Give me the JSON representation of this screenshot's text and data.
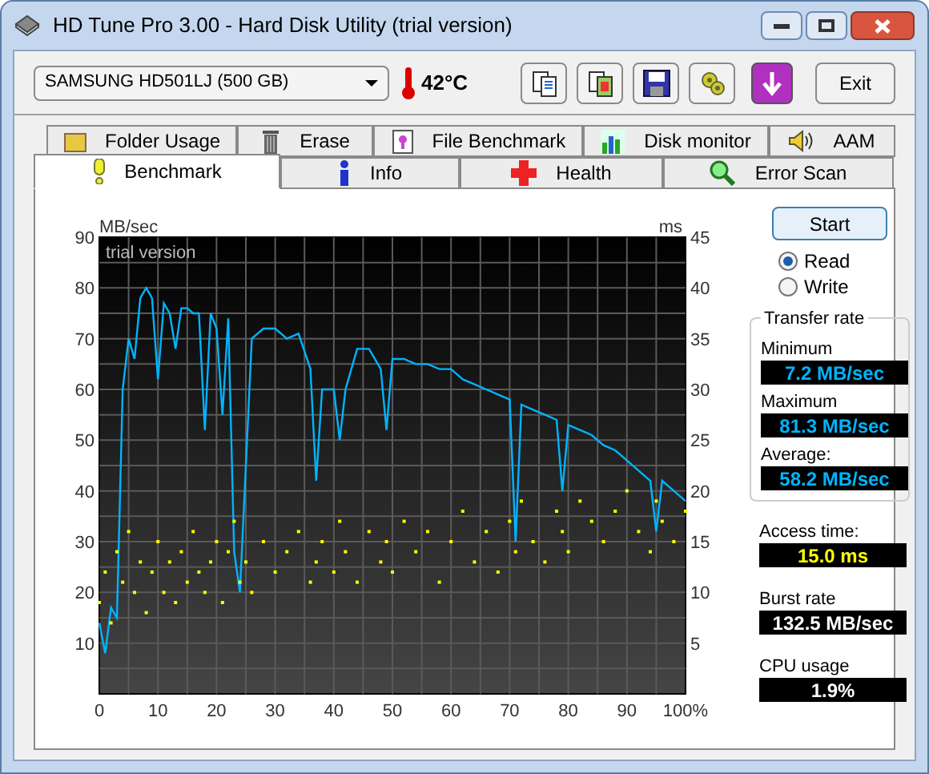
{
  "window": {
    "title": "HD Tune Pro 3.00 - Hard Disk Utility (trial version)"
  },
  "toolbar": {
    "drive": "SAMSUNG HD501LJ (500 GB)",
    "temperature": "42°C",
    "exit": "Exit"
  },
  "tabs": [
    [
      {
        "label": "Folder Usage",
        "selected": false
      },
      {
        "label": "Erase",
        "selected": false
      },
      {
        "label": "File Benchmark",
        "selected": false
      },
      {
        "label": "Disk monitor",
        "selected": false
      },
      {
        "label": "AAM",
        "selected": false
      }
    ],
    [
      {
        "label": "Benchmark",
        "selected": true
      },
      {
        "label": "Info",
        "selected": false
      },
      {
        "label": "Health",
        "selected": false
      },
      {
        "label": "Error Scan",
        "selected": false
      }
    ]
  ],
  "chart_data": {
    "type": "line",
    "ylabel": "MB/sec",
    "y2label": "ms",
    "annotations": [
      "trial version"
    ],
    "xlim": [
      0,
      100
    ],
    "ylim": [
      0,
      90
    ],
    "y2lim": [
      0,
      45
    ],
    "grid": true,
    "xticks": [
      0,
      10,
      20,
      30,
      40,
      50,
      60,
      70,
      80,
      90,
      {
        "value": 100,
        "label": "100%"
      }
    ],
    "yticks": [
      10,
      20,
      30,
      40,
      50,
      60,
      70,
      80,
      90
    ],
    "y2ticks": [
      5,
      10,
      15,
      20,
      25,
      30,
      35,
      40,
      45
    ],
    "x": [
      0,
      1,
      2,
      3,
      4,
      5,
      6,
      7,
      8,
      9,
      10,
      11,
      12,
      13,
      14,
      15,
      16,
      17,
      18,
      19,
      20,
      21,
      22,
      23,
      24,
      25,
      26,
      28,
      30,
      32,
      34,
      36,
      37,
      38,
      40,
      41,
      42,
      44,
      46,
      48,
      49,
      50,
      52,
      54,
      56,
      58,
      60,
      62,
      64,
      66,
      68,
      70,
      71,
      72,
      74,
      76,
      78,
      79,
      80,
      82,
      84,
      86,
      88,
      90,
      92,
      94,
      95,
      96,
      98,
      100
    ],
    "series": [
      {
        "color": "#00b4ff",
        "values": [
          14,
          8,
          17,
          15,
          60,
          70,
          66,
          78,
          80,
          78,
          62,
          77,
          75,
          68,
          76,
          76,
          75,
          75,
          52,
          75,
          72,
          55,
          74,
          28,
          20,
          45,
          70,
          72,
          72,
          70,
          71,
          64,
          42,
          60,
          60,
          50,
          60,
          68,
          68,
          64,
          52,
          66,
          66,
          65,
          65,
          64,
          64,
          62,
          61,
          60,
          59,
          58,
          30,
          57,
          56,
          55,
          54,
          40,
          53,
          52,
          51,
          49,
          48,
          46,
          44,
          42,
          32,
          42,
          40,
          38
        ]
      },
      {
        "axis": "y2",
        "type": "scatter",
        "color": "#ffff00",
        "values": [
          9,
          12,
          7,
          14,
          11,
          16,
          10,
          13,
          8,
          12,
          15,
          10,
          13,
          9,
          14,
          11,
          16,
          12,
          10,
          13,
          15,
          9,
          14,
          17,
          11,
          13,
          10,
          15,
          12,
          14,
          16,
          11,
          13,
          15,
          12,
          17,
          14,
          11,
          16,
          13,
          15,
          12,
          17,
          14,
          16,
          11,
          15,
          18,
          13,
          16,
          12,
          17,
          14,
          19,
          15,
          13,
          18,
          16,
          14,
          19,
          17,
          15,
          18,
          20,
          16,
          14,
          19,
          17,
          15,
          18
        ]
      }
    ]
  },
  "controls": {
    "start": "Start",
    "modes": [
      {
        "label": "Read",
        "selected": true
      },
      {
        "label": "Write",
        "selected": false
      }
    ]
  },
  "transfer_rate": {
    "title": "Transfer rate",
    "readouts": [
      {
        "label": "Minimum",
        "value": "7.2 MB/sec",
        "color": "#00b4ff"
      },
      {
        "label": "Maximum",
        "value": "81.3 MB/sec",
        "color": "#00b4ff"
      },
      {
        "label": "Average:",
        "value": "58.2 MB/sec",
        "color": "#00b4ff"
      }
    ]
  },
  "readouts": [
    {
      "label": "Access time:",
      "value": "15.0 ms",
      "color": "#ffff00"
    },
    {
      "label": "Burst rate",
      "value": "132.5 MB/sec",
      "color": "#ffffff"
    },
    {
      "label": "CPU usage",
      "value": "1.9%",
      "color": "#ffffff"
    }
  ]
}
